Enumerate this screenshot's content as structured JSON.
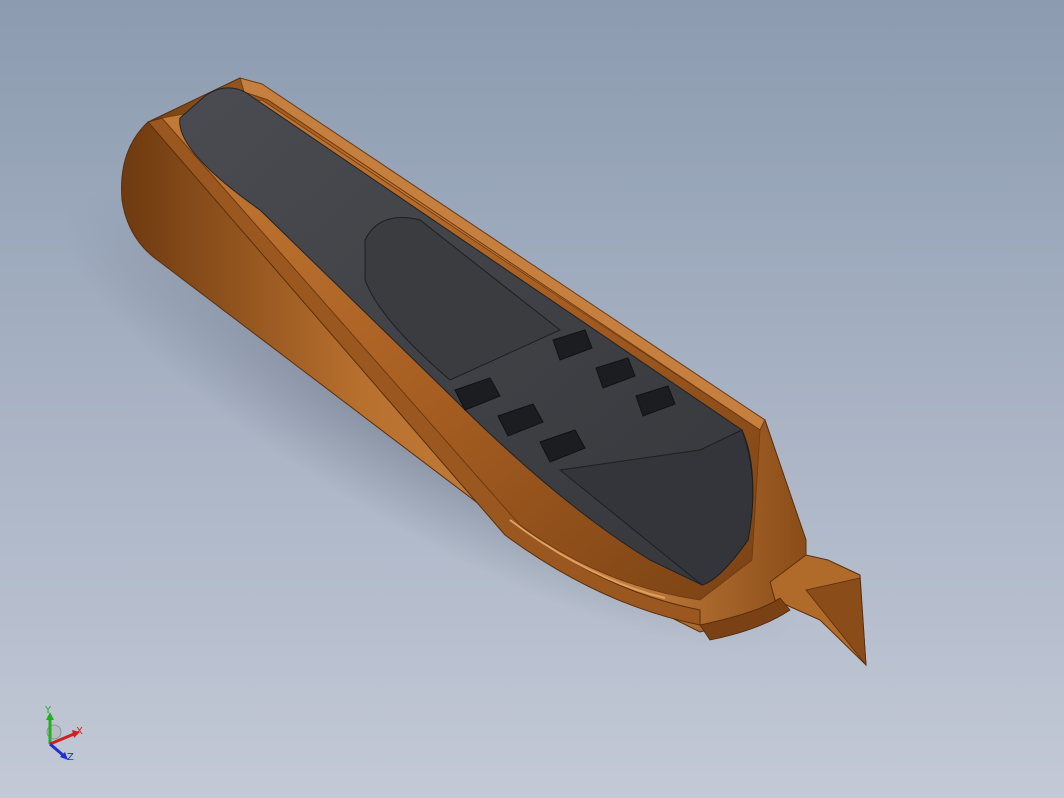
{
  "viewport": {
    "background_top": "#8c9bb0",
    "background_bottom": "#c3c9d6"
  },
  "model": {
    "shell_color": "#b06a2a",
    "shell_dark": "#6e3a10",
    "shell_light": "#d58f4c",
    "core_color": "#3d3f43",
    "core_light": "#55585d"
  },
  "triad": {
    "x_label": "X",
    "y_label": "Y",
    "z_label": "Z",
    "x_color": "#d02020",
    "y_color": "#20b020",
    "z_color": "#2030d0"
  }
}
